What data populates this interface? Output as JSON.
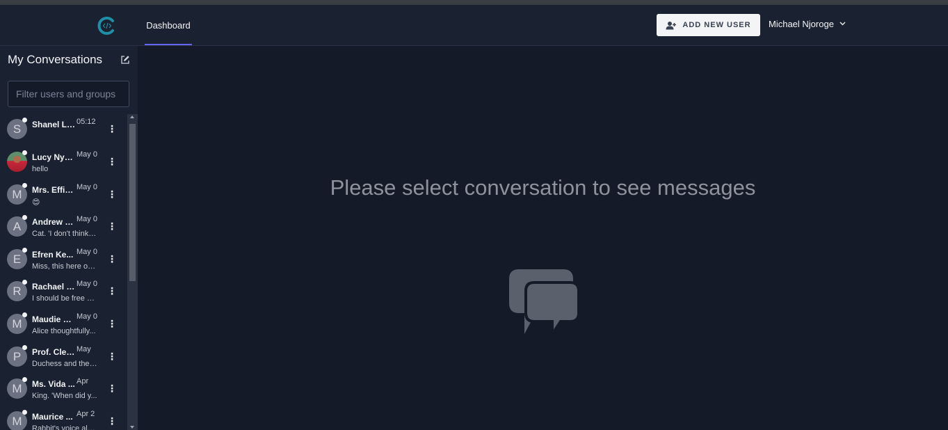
{
  "header": {
    "nav_dashboard": "Dashboard",
    "add_user_label": "ADD NEW USER",
    "user_name": "Michael Njoroge",
    "logo_icon": "app-logo-icon",
    "accent_color": "#6366f1"
  },
  "sidebar": {
    "title": "My Conversations",
    "filter_placeholder": "Filter users and groups",
    "conversations": [
      {
        "initial": "S",
        "name": "Shanel Li...",
        "time": "05:12",
        "preview": ""
      },
      {
        "initial": "",
        "name": "Lucy Nya...",
        "time": "May 0",
        "preview": "hello"
      },
      {
        "initial": "M",
        "name": "Mrs. Effie...",
        "time": "May 0",
        "preview": "😍"
      },
      {
        "initial": "A",
        "name": "Andrew S...",
        "time": "May 0",
        "preview": "Cat. 'I don't think-..."
      },
      {
        "initial": "E",
        "name": "Efren Ke...",
        "time": "May 0",
        "preview": "Miss, this here ou..."
      },
      {
        "initial": "R",
        "name": "Rachael J...",
        "time": "May 0",
        "preview": "I should be free o..."
      },
      {
        "initial": "M",
        "name": "Maudie K...",
        "time": "May 0",
        "preview": "Alice thoughtfully..."
      },
      {
        "initial": "P",
        "name": "Prof. Clet...",
        "time": "May",
        "preview": "Duchess and the l..."
      },
      {
        "initial": "M",
        "name": "Ms. Vida ...",
        "time": "Apr",
        "preview": "King. 'When did y..."
      },
      {
        "initial": "M",
        "name": "Maurice ...",
        "time": "Apr 2",
        "preview": "Rabbit's voice alo..."
      }
    ]
  },
  "main": {
    "empty_message": "Please select conversation to see messages",
    "empty_icon": "chat-bubbles-icon"
  }
}
